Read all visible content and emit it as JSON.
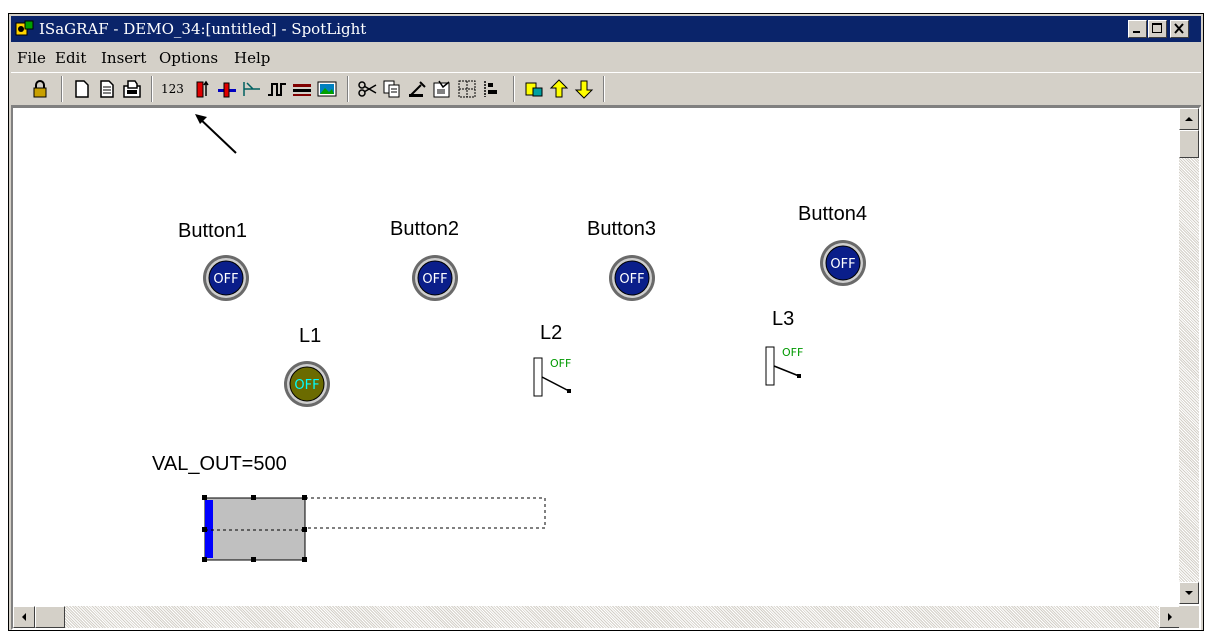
{
  "window": {
    "title": "ISaGRAF - DEMO_34:[untitled] - SpotLight",
    "controls": {
      "minimize": "minimize-icon",
      "maximize": "maximize-icon",
      "close": "close-icon"
    }
  },
  "menu": {
    "items": [
      {
        "label": "File"
      },
      {
        "label": "Edit"
      },
      {
        "label": "Insert"
      },
      {
        "label": "Options"
      },
      {
        "label": "Help"
      }
    ]
  },
  "toolbar": {
    "number_label": "123",
    "icons": [
      "lock-icon",
      "new-icon",
      "open-icon",
      "save-icon",
      "number-display-icon",
      "bar-icon",
      "slider-icon",
      "switch-icon",
      "digital-icon",
      "colorbar-icon",
      "bitmap-icon",
      "cut-icon",
      "copy-icon",
      "paste-icon",
      "properties-icon",
      "grid-icon",
      "align-icon",
      "link-icon",
      "arrow-up-icon",
      "arrow-down-icon"
    ]
  },
  "canvas": {
    "buttons": [
      {
        "label": "Button1",
        "state": "OFF"
      },
      {
        "label": "Button2",
        "state": "OFF"
      },
      {
        "label": "Button3",
        "state": "OFF"
      },
      {
        "label": "Button4",
        "state": "OFF"
      }
    ],
    "lamps": [
      {
        "label": "L1",
        "state": "OFF"
      },
      {
        "label": "L2",
        "state": "OFF"
      },
      {
        "label": "L3",
        "state": "OFF"
      }
    ],
    "value_label": "VAL_OUT=500"
  },
  "colors": {
    "titlebar": "#0a246a",
    "button_face": "#0a1e8a",
    "lamp_face": "#6b6b00",
    "switch_text": "#009900",
    "bar_fill": "#0000ff"
  }
}
